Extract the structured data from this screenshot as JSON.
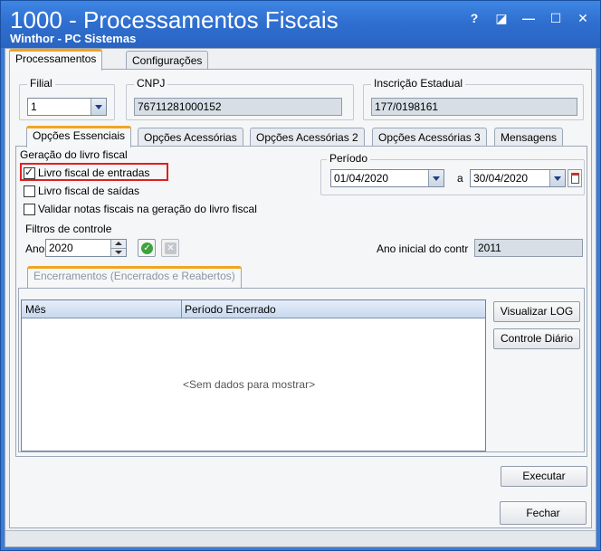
{
  "window": {
    "title": "1000 - Processamentos Fiscais",
    "subtitle": "Winthor - PC Sistemas",
    "buttons": [
      "?",
      "◪",
      "—",
      "☐",
      "✕"
    ]
  },
  "main_tabs": [
    "Processamentos",
    "Configurações"
  ],
  "filial": {
    "label": "Filial",
    "value": "1"
  },
  "cnpj": {
    "label": "CNPJ",
    "value": "76711281000152"
  },
  "ie": {
    "label": "Inscrição Estadual",
    "value": "177/0198161"
  },
  "sub_tabs": [
    "Opções Essenciais",
    "Opções Acessórias",
    "Opções Acessórias 2",
    "Opções Acessórias 3",
    "Mensagens"
  ],
  "geracao": {
    "label": "Geração do livro fiscal",
    "checkboxes": [
      {
        "label": "Livro fiscal de entradas",
        "checked": true
      },
      {
        "label": "Livro fiscal de saídas",
        "checked": false
      },
      {
        "label": "Validar notas fiscais na geração do livro fiscal",
        "checked": false
      }
    ]
  },
  "periodo": {
    "label": "Período",
    "start": "01/04/2020",
    "sep": "a",
    "end": "30/04/2020"
  },
  "filtros": {
    "label": "Filtros de controle",
    "ano_label": "Ano",
    "ano_value": "2020",
    "ano_inicial_label": "Ano inicial do contr",
    "ano_inicial_value": "2011"
  },
  "encerramentos": {
    "tab_label": "Encerramentos (Encerrados e Reabertos)",
    "columns": [
      "Mês",
      "Período Encerrado"
    ],
    "empty_text": "<Sem dados para mostrar>",
    "btn_log": "Visualizar LOG",
    "btn_controle": "Controle Diário"
  },
  "actions": {
    "executar": "Executar",
    "fechar": "Fechar"
  },
  "colors": {
    "title_blue": "#2f6fd0",
    "highlight_red": "#e02020",
    "accent_orange": "#f1a521"
  }
}
